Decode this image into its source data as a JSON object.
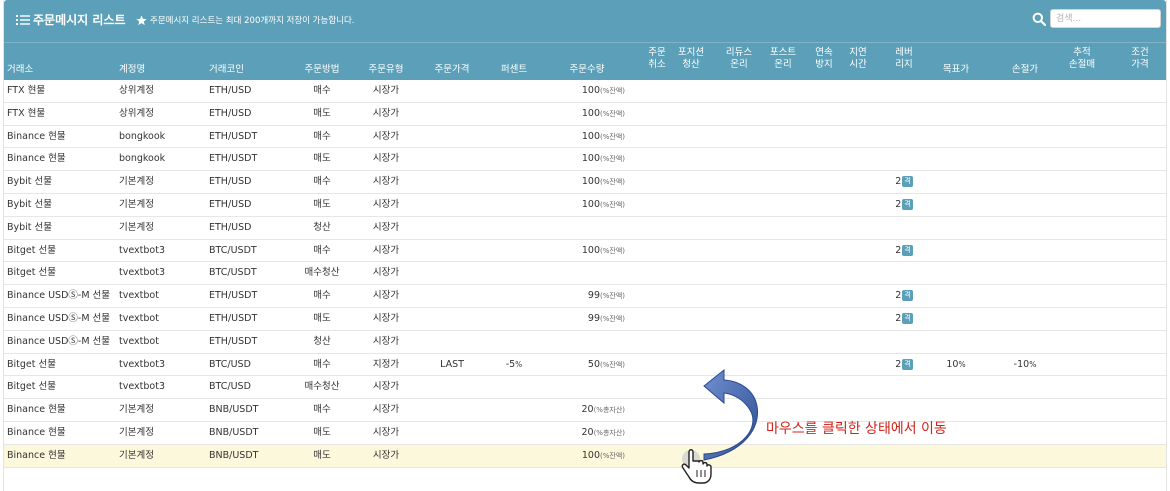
{
  "header": {
    "title": "주문메시지 리스트",
    "notice": "주문메시지 리스트는 최대 200개까지 저장이 가능합니다.",
    "search": {
      "placeholder": "검색..."
    }
  },
  "columns": [
    {
      "key": "exchange",
      "l1": "거래소",
      "l2": ""
    },
    {
      "key": "account",
      "l1": "계정명",
      "l2": ""
    },
    {
      "key": "coin",
      "l1": "거래코인",
      "l2": ""
    },
    {
      "key": "method",
      "l1": "주문방법",
      "l2": ""
    },
    {
      "key": "type",
      "l1": "주문유형",
      "l2": ""
    },
    {
      "key": "price",
      "l1": "주문가격",
      "l2": ""
    },
    {
      "key": "percent",
      "l1": "퍼센트",
      "l2": ""
    },
    {
      "key": "qty",
      "l1": "주문수량",
      "l2": ""
    },
    {
      "key": "cancel",
      "l1": "주문",
      "l2": "취소"
    },
    {
      "key": "close",
      "l1": "포지션",
      "l2": "청산"
    },
    {
      "key": "reduce",
      "l1": "리듀스",
      "l2": "온리"
    },
    {
      "key": "post",
      "l1": "포스트",
      "l2": "온리"
    },
    {
      "key": "consec",
      "l1": "연속",
      "l2": "방지"
    },
    {
      "key": "delay",
      "l1": "지연",
      "l2": "시간"
    },
    {
      "key": "leverage",
      "l1": "레버",
      "l2": "리지"
    },
    {
      "key": "target",
      "l1": "목표가",
      "l2": ""
    },
    {
      "key": "stoploss",
      "l1": "손절가",
      "l2": ""
    },
    {
      "key": "trailing",
      "l1": "추적",
      "l2": "손절매"
    },
    {
      "key": "condition",
      "l1": "조건",
      "l2": "가격"
    }
  ],
  "rows": [
    {
      "exchange": "FTX 현물",
      "account": "상위계정",
      "coin": "ETH/USD",
      "method": "매수",
      "type": "시장가",
      "price": "",
      "percent": "",
      "qty": "100",
      "qty_unit": "(%잔액)",
      "leverage": "",
      "lev_badge": "",
      "target": "",
      "stoploss": ""
    },
    {
      "exchange": "FTX 현물",
      "account": "상위계정",
      "coin": "ETH/USD",
      "method": "매도",
      "type": "시장가",
      "price": "",
      "percent": "",
      "qty": "100",
      "qty_unit": "(%잔액)",
      "leverage": "",
      "lev_badge": "",
      "target": "",
      "stoploss": ""
    },
    {
      "exchange": "Binance 현물",
      "account": "bongkook",
      "coin": "ETH/USDT",
      "method": "매수",
      "type": "시장가",
      "price": "",
      "percent": "",
      "qty": "100",
      "qty_unit": "(%잔액)",
      "leverage": "",
      "lev_badge": "",
      "target": "",
      "stoploss": ""
    },
    {
      "exchange": "Binance 현물",
      "account": "bongkook",
      "coin": "ETH/USDT",
      "method": "매도",
      "type": "시장가",
      "price": "",
      "percent": "",
      "qty": "100",
      "qty_unit": "(%잔액)",
      "leverage": "",
      "lev_badge": "",
      "target": "",
      "stoploss": ""
    },
    {
      "exchange": "Bybit 선물",
      "account": "기본계정",
      "coin": "ETH/USD",
      "method": "매수",
      "type": "시장가",
      "price": "",
      "percent": "",
      "qty": "100",
      "qty_unit": "(%잔액)",
      "leverage": "2",
      "lev_badge": "격",
      "target": "",
      "stoploss": ""
    },
    {
      "exchange": "Bybit 선물",
      "account": "기본계정",
      "coin": "ETH/USD",
      "method": "매도",
      "type": "시장가",
      "price": "",
      "percent": "",
      "qty": "100",
      "qty_unit": "(%잔액)",
      "leverage": "2",
      "lev_badge": "격",
      "target": "",
      "stoploss": ""
    },
    {
      "exchange": "Bybit 선물",
      "account": "기본계정",
      "coin": "ETH/USD",
      "method": "청산",
      "type": "시장가",
      "price": "",
      "percent": "",
      "qty": "",
      "qty_unit": "",
      "leverage": "",
      "lev_badge": "",
      "target": "",
      "stoploss": ""
    },
    {
      "exchange": "Bitget 선물",
      "account": "tvextbot3",
      "coin": "BTC/USDT",
      "method": "매수",
      "type": "시장가",
      "price": "",
      "percent": "",
      "qty": "100",
      "qty_unit": "(%잔액)",
      "leverage": "2",
      "lev_badge": "격",
      "target": "",
      "stoploss": ""
    },
    {
      "exchange": "Bitget 선물",
      "account": "tvextbot3",
      "coin": "BTC/USDT",
      "method": "매수청산",
      "type": "시장가",
      "price": "",
      "percent": "",
      "qty": "",
      "qty_unit": "",
      "leverage": "",
      "lev_badge": "",
      "target": "",
      "stoploss": ""
    },
    {
      "exchange": "Binance USDⓈ-M 선물",
      "account": "tvextbot",
      "coin": "ETH/USDT",
      "method": "매수",
      "type": "시장가",
      "price": "",
      "percent": "",
      "qty": "99",
      "qty_unit": "(%잔액)",
      "leverage": "2",
      "lev_badge": "격",
      "target": "",
      "stoploss": ""
    },
    {
      "exchange": "Binance USDⓈ-M 선물",
      "account": "tvextbot",
      "coin": "ETH/USDT",
      "method": "매도",
      "type": "시장가",
      "price": "",
      "percent": "",
      "qty": "99",
      "qty_unit": "(%잔액)",
      "leverage": "2",
      "lev_badge": "격",
      "target": "",
      "stoploss": ""
    },
    {
      "exchange": "Binance USDⓈ-M 선물",
      "account": "tvextbot",
      "coin": "ETH/USDT",
      "method": "청산",
      "type": "시장가",
      "price": "",
      "percent": "",
      "qty": "",
      "qty_unit": "",
      "leverage": "",
      "lev_badge": "",
      "target": "",
      "stoploss": ""
    },
    {
      "exchange": "Bitget 선물",
      "account": "tvextbot3",
      "coin": "BTC/USD",
      "method": "매수",
      "type": "지정가",
      "price": "LAST",
      "percent": "-5",
      "percent_unit": "%",
      "qty": "50",
      "qty_unit": "(%잔액)",
      "leverage": "2",
      "lev_badge": "격",
      "target": "10",
      "target_unit": "%",
      "stoploss": "-10",
      "stoploss_unit": "%"
    },
    {
      "exchange": "Bitget 선물",
      "account": "tvextbot3",
      "coin": "BTC/USD",
      "method": "매수청산",
      "type": "시장가",
      "price": "",
      "percent": "",
      "qty": "",
      "qty_unit": "",
      "leverage": "",
      "lev_badge": "",
      "target": "",
      "stoploss": ""
    },
    {
      "exchange": "Binance 현물",
      "account": "기본계정",
      "coin": "BNB/USDT",
      "method": "매수",
      "type": "시장가",
      "price": "",
      "percent": "",
      "qty": "20",
      "qty_unit": "(%총자산)",
      "leverage": "",
      "lev_badge": "",
      "target": "",
      "stoploss": ""
    },
    {
      "exchange": "Binance 현물",
      "account": "기본계정",
      "coin": "BNB/USDT",
      "method": "매도",
      "type": "시장가",
      "price": "",
      "percent": "",
      "qty": "20",
      "qty_unit": "(%총자산)",
      "leverage": "",
      "lev_badge": "",
      "target": "",
      "stoploss": ""
    },
    {
      "exchange": "Binance 현물",
      "account": "기본계정",
      "coin": "BNB/USDT",
      "method": "매도",
      "type": "시장가",
      "price": "",
      "percent": "",
      "qty": "100",
      "qty_unit": "(%잔액)",
      "leverage": "",
      "lev_badge": "",
      "target": "",
      "stoploss": "",
      "selected": true
    }
  ],
  "annotation": {
    "text": "마우스를 클릭한 상태에서 이동"
  },
  "icons": {
    "title": "list-icon",
    "notice": "star-icon",
    "search": "search-icon",
    "cursor": "hand-pointer-icon",
    "drag": "curved-arrow-icon"
  },
  "colors": {
    "header_bg": "#5b9fb8",
    "selected_row_bg": "#fcf8dc",
    "annotation": "#d2221a",
    "arrow": "#3d5fa8"
  }
}
